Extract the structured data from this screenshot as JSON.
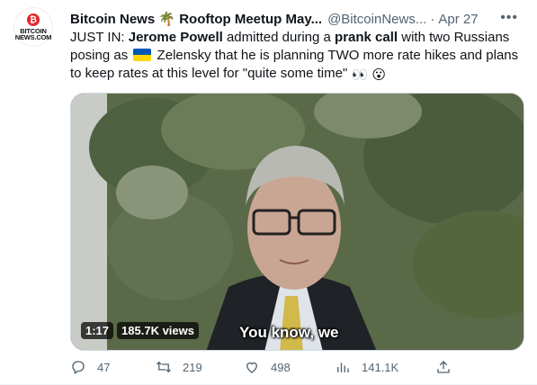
{
  "account": {
    "display_name": "Bitcoin News 🌴 Rooftop Meetup May...",
    "handle": "@BitcoinNews...",
    "separator": "·",
    "date": "Apr 27",
    "avatar_brand": "BITCOIN NEWS.COM",
    "avatar_coin": "₿"
  },
  "tweet": {
    "p1": "JUST IN: ",
    "b1": "Jerome Powell",
    "p2": " admitted during a ",
    "b2": "prank call",
    "p3": " with two Russians posing as ",
    "p4": " Zelensky that he is planning TWO more rate hikes and plans to keep rates at this level for \"quite some time\" ",
    "emoji_eyes": "👀",
    "emoji_wow": "😮"
  },
  "video": {
    "time": "1:17",
    "views": "185.7K views",
    "caption": "You know, we"
  },
  "actions": {
    "replies": "47",
    "retweets": "219",
    "likes": "498",
    "views": "141.1K"
  },
  "colors": {
    "text": "#0f1419",
    "secondary": "#536471",
    "flag_blue": "#0057b7",
    "flag_yellow": "#ffd700"
  },
  "icons": [
    "more-icon",
    "reply-icon",
    "retweet-icon",
    "like-icon",
    "views-icon",
    "share-icon"
  ]
}
